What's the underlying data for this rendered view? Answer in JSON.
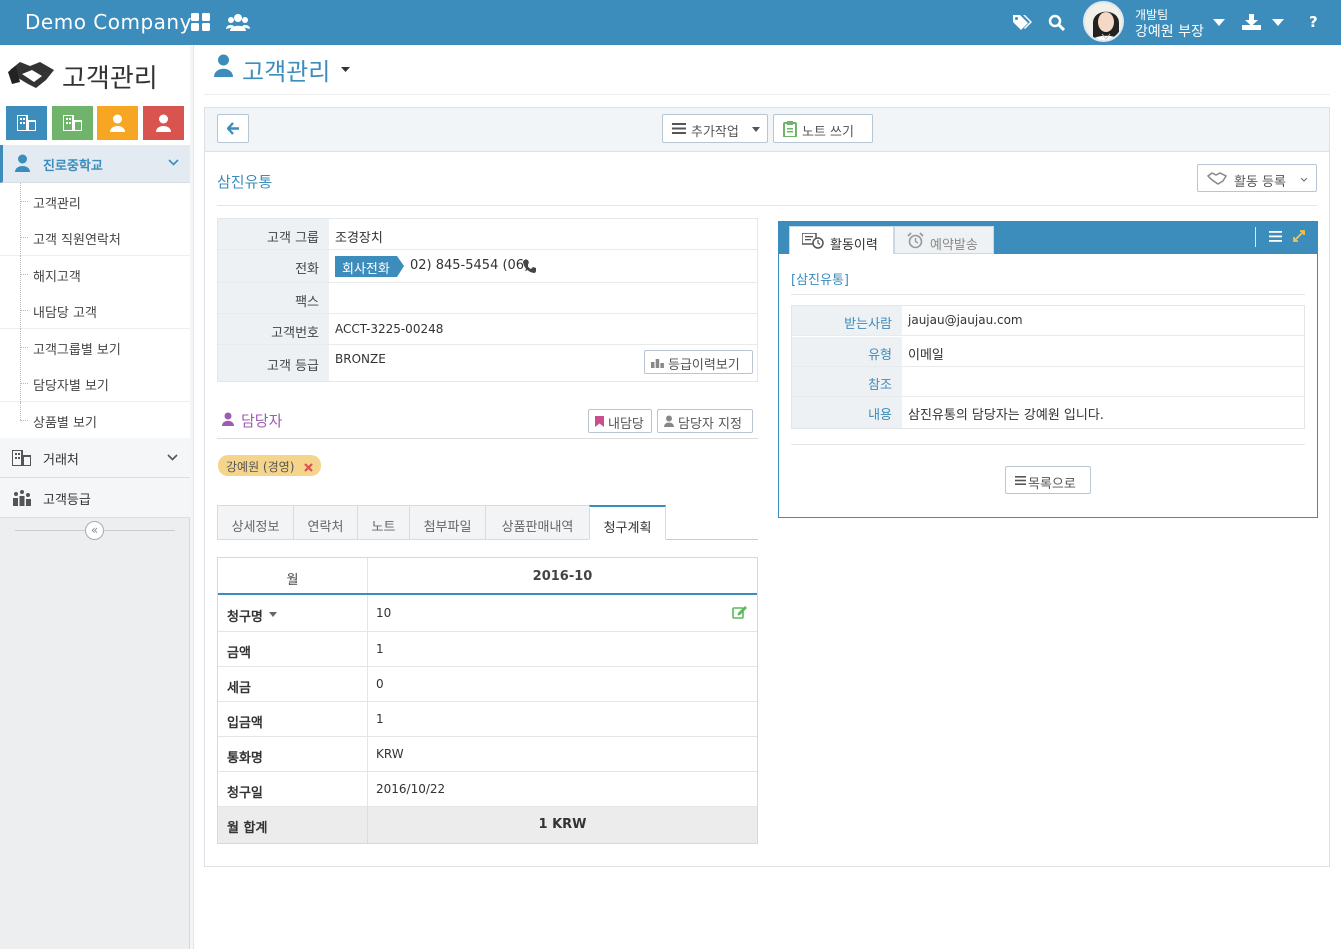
{
  "header": {
    "brand": "Demo Company",
    "user_team": "개발팀",
    "user_name": "강예원 부장",
    "help": "?"
  },
  "sidebar": {
    "title": "고객관리",
    "tile_colors": [
      "#3c8dbc",
      "#6fb46a",
      "#f6a623",
      "#d9534f"
    ],
    "active_group": "진로중학교",
    "sub_items": [
      "고객관리",
      "고객 직원연락처",
      "해지고객",
      "내담당 고객",
      "고객그룹별 보기",
      "담당자별 보기",
      "상품별 보기"
    ],
    "groups": [
      "거래처",
      "고객등급"
    ],
    "collapse_icon": "«"
  },
  "page": {
    "title": "고객관리",
    "toolbar": {
      "more_actions": "추가작업",
      "write_note": "노트 쓰기"
    },
    "customer_name": "삼진유통",
    "activity_register": "활동 등록",
    "info": {
      "group_label": "고객 그룹",
      "group_value": "조경장치",
      "phone_label": "전화",
      "phone_tag": "회사전화",
      "phone_value": "02) 845-5454 (06)",
      "fax_label": "팩스",
      "fax_value": "",
      "number_label": "고객번호",
      "number_value": "ACCT-3225-00248",
      "grade_label": "고객 등급",
      "grade_value": "BRONZE",
      "grade_history": "등급이력보기"
    },
    "manager": {
      "title": "담당자",
      "my_button": "내담당",
      "assign_button": "담당자 지정",
      "chip": "강예원 (경영)"
    },
    "tabs": [
      "상세정보",
      "연락처",
      "노트",
      "첨부파일",
      "상품판매내역",
      "청구계획"
    ],
    "billing": {
      "col_month": "월",
      "col_period": "2016-10",
      "rows": [
        {
          "label": "청구명",
          "value": "10"
        },
        {
          "label": "금액",
          "value": "1"
        },
        {
          "label": "세금",
          "value": "0"
        },
        {
          "label": "입금액",
          "value": "1"
        },
        {
          "label": "통화명",
          "value": "KRW"
        },
        {
          "label": "청구일",
          "value": "2016/10/22"
        }
      ],
      "total_label": "월 합계",
      "total_value": "1 KRW"
    },
    "activity": {
      "tab_history": "활동이력",
      "tab_scheduled": "예약발송",
      "link": "[삼진유통]",
      "recipient_label": "받는사람",
      "recipient_value": "jaujau@jaujau.com",
      "type_label": "유형",
      "type_value": "이메일",
      "ref_label": "참조",
      "ref_value": "",
      "content_label": "내용",
      "content_value": "삼진유통의 담당자는 강예원 입니다.",
      "back_to_list": "목록으로"
    }
  }
}
